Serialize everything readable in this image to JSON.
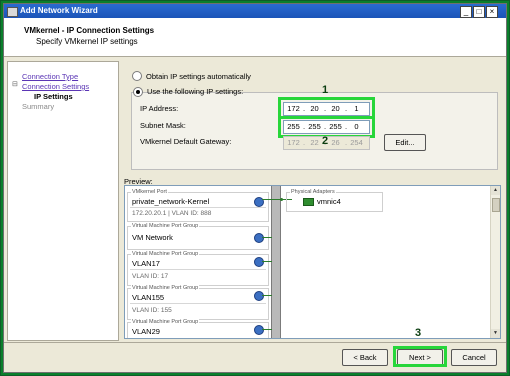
{
  "window": {
    "title": "Add Network Wizard",
    "controls": [
      "_",
      "□",
      "×"
    ]
  },
  "header": {
    "title": "VMkernel - IP Connection Settings",
    "subtitle": "Specify VMkernel IP settings"
  },
  "nav": {
    "items": [
      {
        "label": "Connection Type",
        "state": "link"
      },
      {
        "label": "Connection Settings",
        "state": "link"
      },
      {
        "label": "IP Settings",
        "state": "current"
      },
      {
        "label": "Summary",
        "state": "disabled"
      }
    ]
  },
  "ip": {
    "auto_label": "Obtain IP settings automatically",
    "manual_label": "Use the following IP settings:",
    "ip_label": "IP Address:",
    "ip_value": [
      "172",
      "20",
      "20",
      "1"
    ],
    "mask_label": "Subnet Mask:",
    "mask_value": [
      "255",
      "255",
      "255",
      "0"
    ],
    "gateway_label": "VMkernel Default Gateway:",
    "gateway_value": [
      "172",
      "22",
      "26",
      "254"
    ],
    "edit_label": "Edit..."
  },
  "markers": [
    "1",
    "2",
    "3"
  ],
  "preview": {
    "label": "Preview:",
    "vmkernel": {
      "caption": "VMkernel Port",
      "name": "private_network-Kernel",
      "detail": "172.20.20.1 | VLAN ID: 888"
    },
    "vm_groups": [
      {
        "caption": "Virtual Machine Port Group",
        "name": "VM Network",
        "vlan": ""
      },
      {
        "caption": "Virtual Machine Port Group",
        "name": "VLAN17",
        "vlan": "VLAN ID: 17"
      },
      {
        "caption": "Virtual Machine Port Group",
        "name": "VLAN155",
        "vlan": "VLAN ID: 155"
      },
      {
        "caption": "Virtual Machine Port Group",
        "name": "VLAN29",
        "vlan": ""
      }
    ],
    "physical": {
      "caption": "Physical Adapters",
      "nic": "vmnic4"
    }
  },
  "footer": {
    "back_label": "< Back",
    "next_label": "Next >",
    "cancel_label": "Cancel"
  },
  "colors": {
    "highlight": "#27d63a",
    "link": "#5b36b5",
    "title_bar": "#1b54b8"
  }
}
